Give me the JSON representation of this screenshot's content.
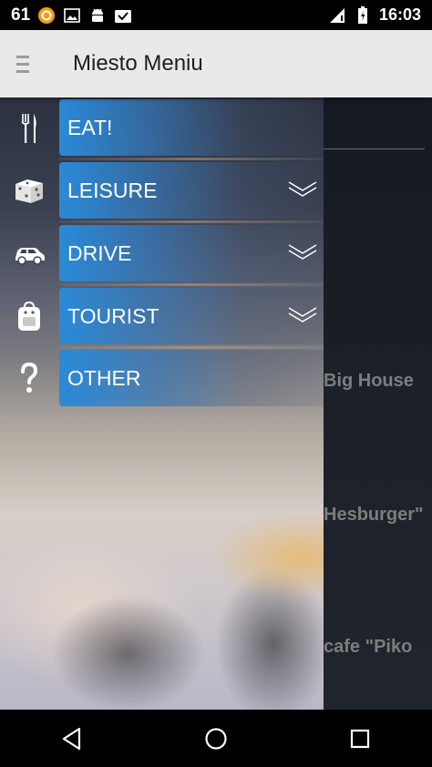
{
  "status_bar": {
    "notification_count": "61",
    "time": "16:03",
    "icons": [
      "notification-icon",
      "image-icon",
      "android-icon",
      "inbox-check-icon",
      "signal-icon",
      "battery-icon"
    ]
  },
  "app_bar": {
    "title": "Miesto Meniu",
    "menu_icon": "hamburger-icon"
  },
  "drawer": {
    "items": [
      {
        "label": "EAT!",
        "icon": "fork-knife-icon",
        "expandable": false
      },
      {
        "label": "LEISURE",
        "icon": "dice-icon",
        "expandable": true
      },
      {
        "label": "DRIVE",
        "icon": "car-icon",
        "expandable": true
      },
      {
        "label": "TOURIST",
        "icon": "backpack-icon",
        "expandable": true
      },
      {
        "label": "OTHER",
        "icon": "question-icon",
        "expandable": false
      }
    ]
  },
  "content": {
    "list": [
      {
        "text": "Big House"
      },
      {
        "text": "Hesburger\""
      },
      {
        "text": "cafe \"Piko"
      }
    ]
  },
  "nav_bar": {
    "buttons": [
      "back-icon",
      "home-icon",
      "recents-icon"
    ]
  },
  "colors": {
    "accent": "#2a8ad8",
    "app_bar_bg": "#e9e9ea"
  }
}
